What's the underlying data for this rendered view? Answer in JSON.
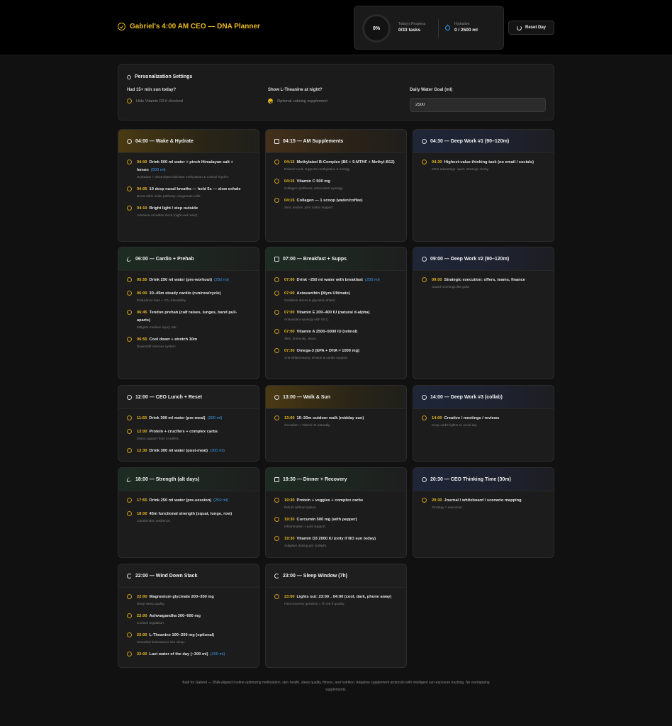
{
  "header": {
    "title": "Gabriel's 4:00 AM CEO — DNA Planner",
    "progress_percent": "0%",
    "progress_label": "Today's Progress",
    "progress_value": "0/33 tasks",
    "hydration_label": "Hydration",
    "hydration_value": "0 / 2500 ml",
    "reset_label": "Reset Day"
  },
  "settings": {
    "title": "Personalization Settings",
    "sun_question": "Had 15+ min sun today?",
    "sun_option": "Hide Vitamin D3 if checked",
    "sun_checked": false,
    "theanine_question": "Show L-Theanine at night?",
    "theanine_option": "Optional calming supplement",
    "theanine_checked": true,
    "water_label": "Daily Water Goal (ml)",
    "water_value": "2500"
  },
  "cards": [
    {
      "title": "04:00 — Wake & Hydrate",
      "icon": "sun-icon",
      "tasks": [
        {
          "time": "04:00",
          "text": "Drink 500 ml water + pinch Himalayan salt + lemon",
          "badge": "(500 ml)",
          "note": "Hydration + electrolytes kickstart methylation & cortisol rhythm."
        },
        {
          "time": "04:05",
          "text": "10 deep nasal breaths — hold 5s — slow exhale",
          "badge": "",
          "note": "Boost nitric oxide pathway; oxygenate cells."
        },
        {
          "time": "04:10",
          "text": "Bright light / step outside",
          "badge": "",
          "note": "Advance circadian clock (night-owl reset)."
        }
      ]
    },
    {
      "title": "04:15 — AM Supplements",
      "icon": "cup-icon",
      "tasks": [
        {
          "time": "04:15",
          "text": "Methylated B-Complex (B6 + 5-MTHF + Methyl-B12)",
          "badge": "",
          "note": "Raised need; supports methylation & energy."
        },
        {
          "time": "04:15",
          "text": "Vitamin C 500 mg",
          "badge": "",
          "note": "Collagen synthesis; antioxidant synergy."
        },
        {
          "time": "04:15",
          "text": "Collagen — 1 scoop (water/coffee)",
          "badge": "",
          "note": "Skin, tendon, joint matrix support."
        }
      ]
    },
    {
      "title": "04:30 — Deep Work #1 (90–120m)",
      "icon": "brain-icon",
      "tasks": [
        {
          "time": "04:30",
          "text": "Highest-value thinking task (no email / socials)",
          "badge": "",
          "note": "CEO advantage: quiet, strategic clarity."
        }
      ]
    },
    {
      "title": "06:00 — Cardio + Prehab",
      "icon": "pulse-icon",
      "tasks": [
        {
          "time": "05:55",
          "text": "Drink 250 ml water (pre-workout)",
          "badge": "(250 ml)",
          "note": ""
        },
        {
          "time": "06:00",
          "text": "30–45m steady cardio (run/row/cycle)",
          "badge": "",
          "note": "Endurance bias + VO₂ trainability."
        },
        {
          "time": "06:45",
          "text": "Tendon prehab (calf raises, lunges, band pull-aparts)",
          "badge": "",
          "note": "Mitigate medium injury risk."
        },
        {
          "time": "06:55",
          "text": "Cool down + stretch 10m",
          "badge": "",
          "note": "Downshift nervous system."
        }
      ]
    },
    {
      "title": "07:00 — Breakfast + Supps",
      "icon": "list-icon",
      "tasks": [
        {
          "time": "07:00",
          "text": "Drink ~250 ml water with breakfast",
          "badge": "(250 ml)",
          "note": ""
        },
        {
          "time": "07:00",
          "text": "Astaxanthin (Myra Ultimate)",
          "badge": "",
          "note": "Oxidative stress & glycation shield."
        },
        {
          "time": "07:00",
          "text": "Vitamin E 200–400 IU (natural d-alpha)",
          "badge": "",
          "note": "Antioxidant synergy with Vit C."
        },
        {
          "time": "07:00",
          "text": "Vitamin A 2500–5000 IU (retinol)",
          "badge": "",
          "note": "Skin, immunity, vision."
        },
        {
          "time": "07:30",
          "text": "Omega-3 (EPA + DHA ≈ 1000 mg)",
          "badge": "",
          "note": "Anti-inflammatory; tendon & cardio support."
        }
      ]
    },
    {
      "title": "09:00 — Deep Work #2 (90–120m)",
      "icon": "brain-icon",
      "tasks": [
        {
          "time": "09:00",
          "text": "Strategic execution: offers, teams, finance",
          "badge": "",
          "note": "Guard mornings like gold."
        }
      ]
    },
    {
      "title": "12:00 — CEO Lunch + Reset",
      "icon": "drop-icon",
      "tasks": [
        {
          "time": "11:55",
          "text": "Drink 300 ml water (pre-meal)",
          "badge": "(300 ml)",
          "note": ""
        },
        {
          "time": "12:00",
          "text": "Protein + crucifers + complex carbs",
          "badge": "",
          "note": "Detox support from crucifers."
        },
        {
          "time": "12:30",
          "text": "Drink 300 ml water (post-meal)",
          "badge": "(300 ml)",
          "note": ""
        }
      ]
    },
    {
      "title": "13:00 — Walk & Sun",
      "icon": "sun-icon",
      "tasks": [
        {
          "time": "13:00",
          "text": "15–20m outdoor walk (midday sun)",
          "badge": "",
          "note": "Circadian + Vitamin D naturally."
        }
      ]
    },
    {
      "title": "14:00 — Deep Work #3 (collab)",
      "icon": "brain-icon",
      "tasks": [
        {
          "time": "14:00",
          "text": "Creative / meetings / reviews",
          "badge": "",
          "note": "Keep carbs lighter to avoid dip."
        }
      ]
    },
    {
      "title": "18:00 — Strength (alt days)",
      "icon": "pulse-icon",
      "tasks": [
        {
          "time": "17:55",
          "text": "Drink 250 ml water (pre-session)",
          "badge": "(250 ml)",
          "note": ""
        },
        {
          "time": "18:00",
          "text": "45m functional strength (squat, lunge, row)",
          "badge": "",
          "note": "Joint/tendon resilience."
        }
      ]
    },
    {
      "title": "19:30 — Dinner + Recovery",
      "icon": "list-icon",
      "tasks": [
        {
          "time": "19:30",
          "text": "Protein + veggies + complex carbs",
          "badge": "",
          "note": "Refuel without spikes."
        },
        {
          "time": "19:30",
          "text": "Curcumin 500 mg (with pepper)",
          "badge": "",
          "note": "Inflammation + joint support."
        },
        {
          "time": "19:30",
          "text": "Vitamin D3 2000 IU (only if NO sun today)",
          "badge": "",
          "note": "Adaptive dosing per sunlight."
        }
      ]
    },
    {
      "title": "20:30 — CEO Thinking Time (30m)",
      "icon": "brain-icon",
      "tasks": [
        {
          "time": "20:30",
          "text": "Journal / whiteboard / scenario mapping",
          "badge": "",
          "note": "Strategy > execution."
        }
      ]
    },
    {
      "title": "22:00 — Wind Down Stack",
      "icon": "moon-icon",
      "tasks": [
        {
          "time": "22:00",
          "text": "Magnesium glycinate 200–350 mg",
          "badge": "",
          "note": "Deep sleep quality."
        },
        {
          "time": "22:00",
          "text": "Ashwagandha 300–600 mg",
          "badge": "",
          "note": "Cortisol regulation."
        },
        {
          "time": "22:00",
          "text": "L-Theanine 100–200 mg (optional)",
          "badge": "",
          "note": "Smoother brainwaves into sleep."
        },
        {
          "time": "22:00",
          "text": "Last water of the day (~300 ml)",
          "badge": "(300 ml)",
          "note": ""
        }
      ]
    },
    {
      "title": "23:00 — Sleep Window (7h)",
      "icon": "moon-icon",
      "tasks": [
        {
          "time": "23:00",
          "text": "Lights out: 23:00→04:00 (cool, dark, phone away)",
          "badge": "",
          "note": "Fast recovery genetics = 7h OK if quality."
        }
      ]
    }
  ],
  "footer": {
    "text": "Built for Gabriel — DNA-aligned routine optimizing methylation, skin health, sleep quality, fitness, and nutrition. Adaptive supplement protocols with intelligent sun-exposure tracking. No overlapping supplements."
  },
  "colors": {
    "accent": "#e8b923",
    "water": "#3b9ae8",
    "background": "#111111",
    "card": "#1c1c1c"
  }
}
